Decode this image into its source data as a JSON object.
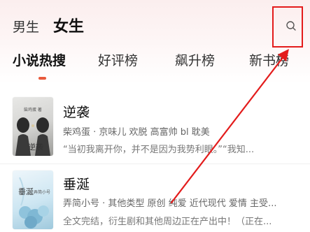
{
  "gender_tabs": [
    "男生",
    "女生"
  ],
  "rank_tabs": [
    "小说热搜",
    "好评榜",
    "飙升榜",
    "新书榜"
  ],
  "active_rank_tab": "小说热搜",
  "search_icon": "search-icon",
  "colors": {
    "accent": "#e85a3c",
    "annotation": "#e31c1c",
    "header_tint": "#fbeeee"
  },
  "books": [
    {
      "title": "逆袭",
      "meta": "柴鸡蛋 · 京味儿 欢脱 高富帅 bl 耽美",
      "description": "“当初我离开你，并不是因为我势利眼。”“我知...",
      "cover_title": "逆袭",
      "cover_caption": "柴鸡蛋 著"
    },
    {
      "title": "垂涎",
      "meta": "弄简小号 · 其他类型 原创 纯爱 近代现代 爱情 主受...",
      "description": "全文完结，衍生剧和其他周边正在产出中！（正在...",
      "cover_title": "垂涎",
      "cover_caption": "弄简小号"
    }
  ]
}
